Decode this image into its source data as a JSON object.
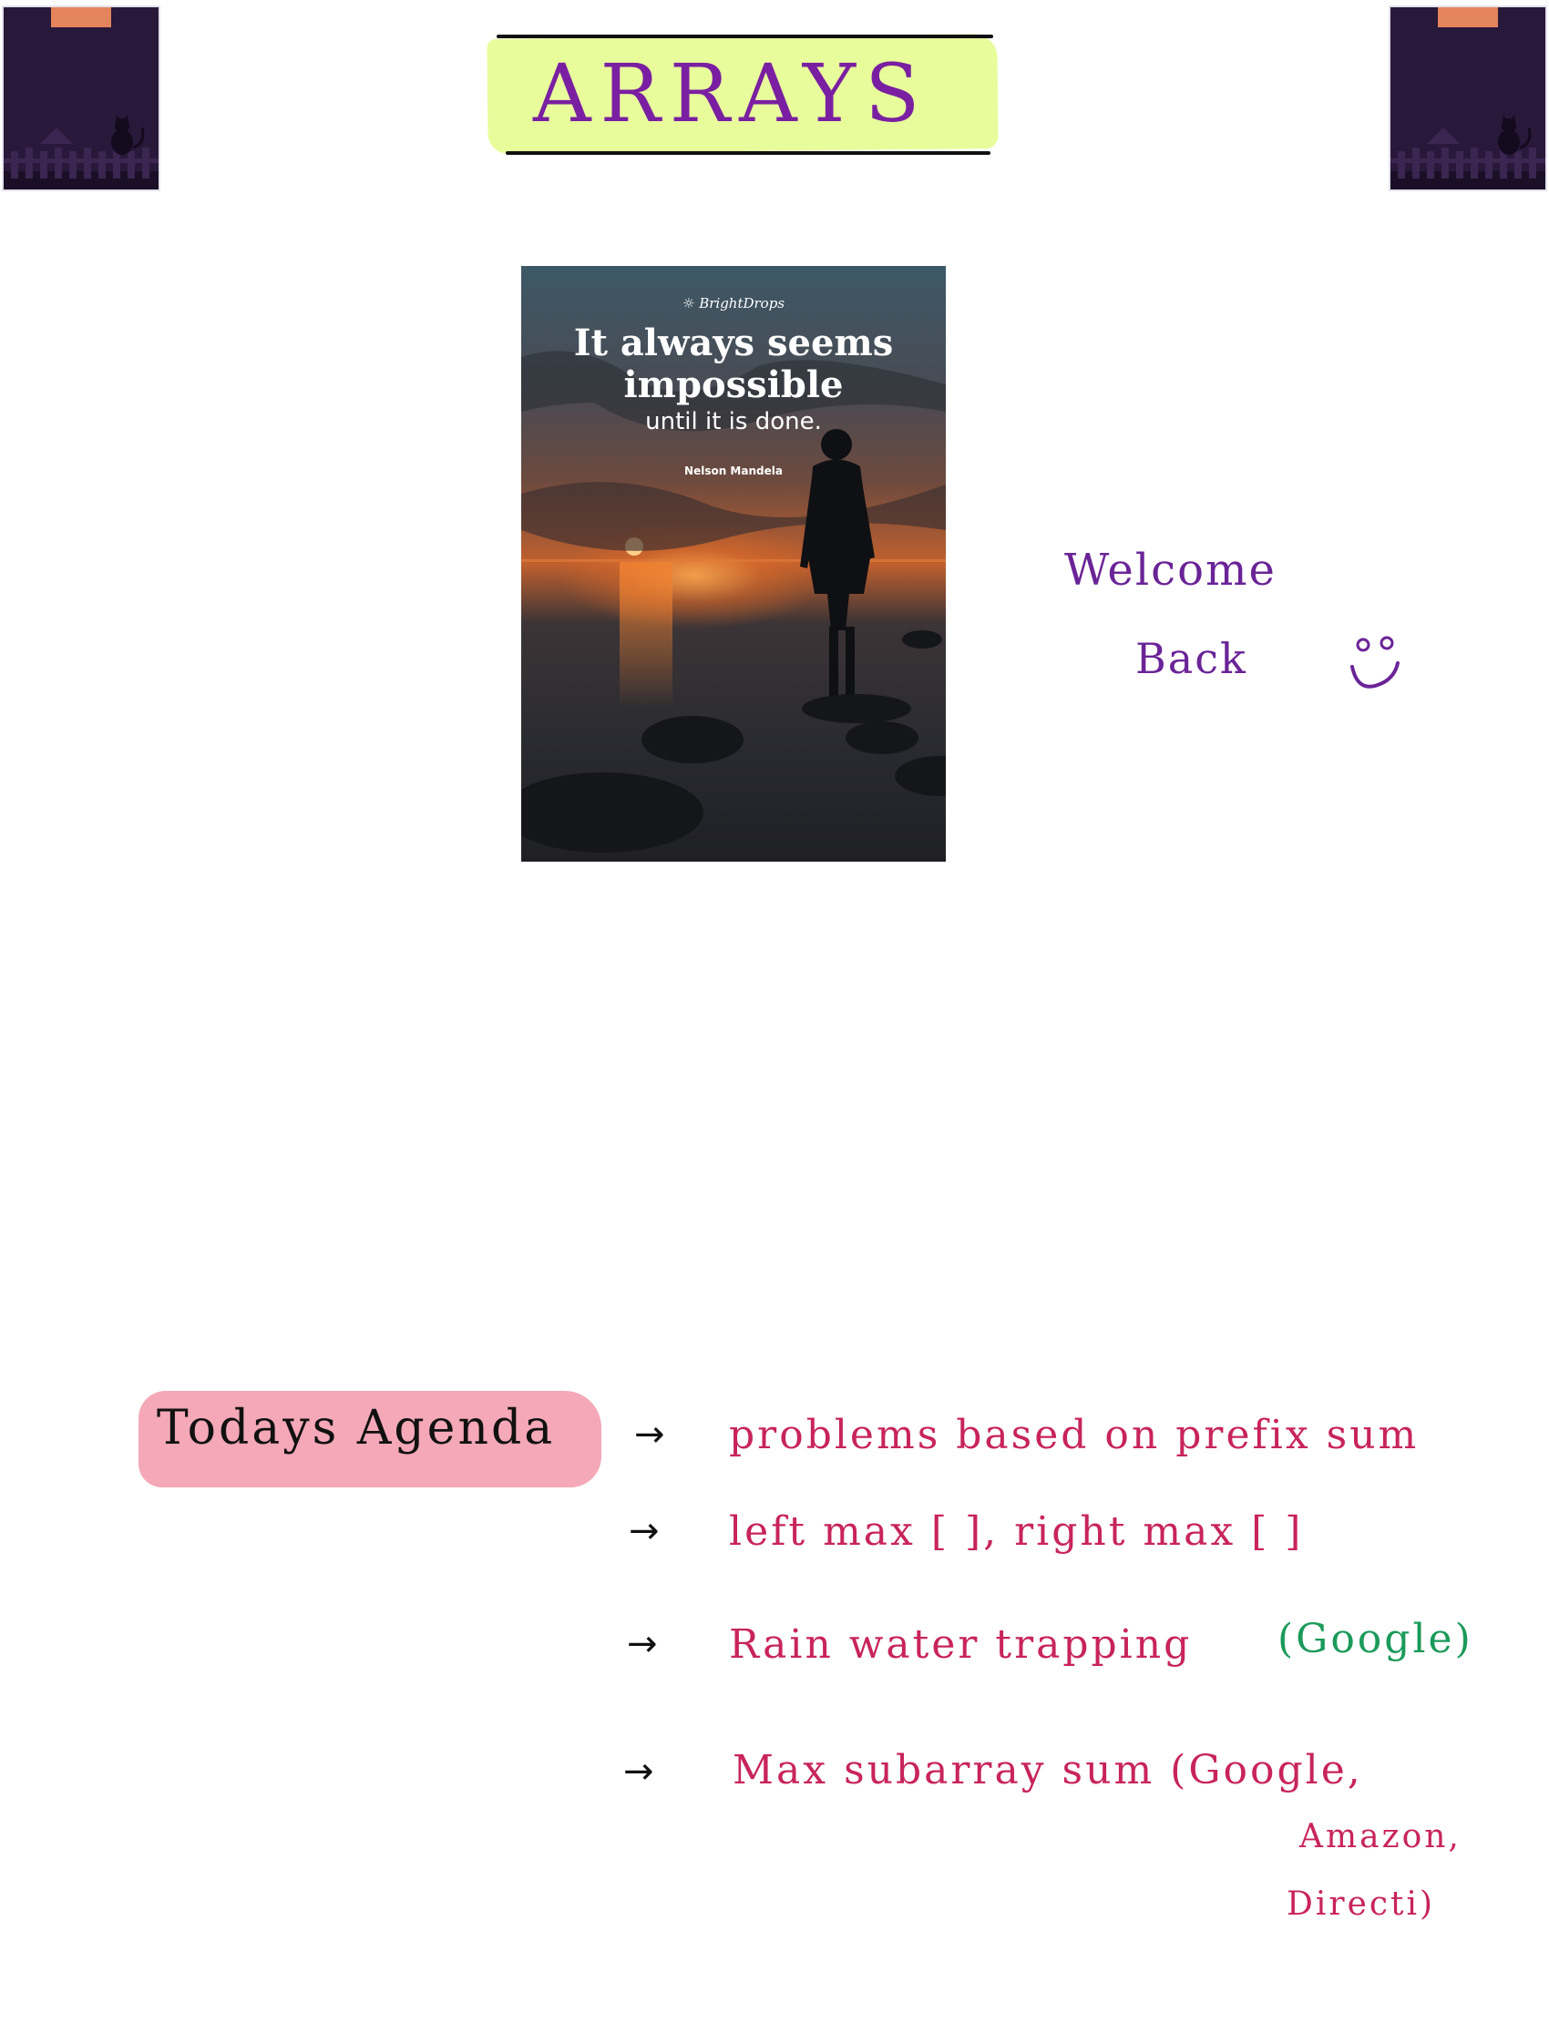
{
  "title": "ARRAYS",
  "poster": {
    "brand": "BrightDrops",
    "quote_line1": "It always seems",
    "quote_line2": "impossible",
    "quote_line3": "until it is done.",
    "author": "Nelson Mandela"
  },
  "welcome": {
    "line1": "Welcome",
    "line2": "Back"
  },
  "agenda": {
    "title": "Todays Agenda",
    "items": [
      {
        "text": "problems based on prefix sum"
      },
      {
        "text": "left max [ ], right max [ ]"
      },
      {
        "text": "Rain water trapping",
        "note": "(Google)"
      },
      {
        "text": "Max subarray sum (Google,",
        "note_line2": "Amazon,",
        "note_line3": "Directi)"
      }
    ]
  },
  "colors": {
    "title_highlight": "#e8fc9c",
    "title_text": "#7a1fa2",
    "welcome_text": "#6a2497",
    "agenda_highlight": "#f4a8b8",
    "agenda_items": "#c8245c",
    "company_note": "#1b9a5a",
    "sticky_note": "#28183a"
  }
}
